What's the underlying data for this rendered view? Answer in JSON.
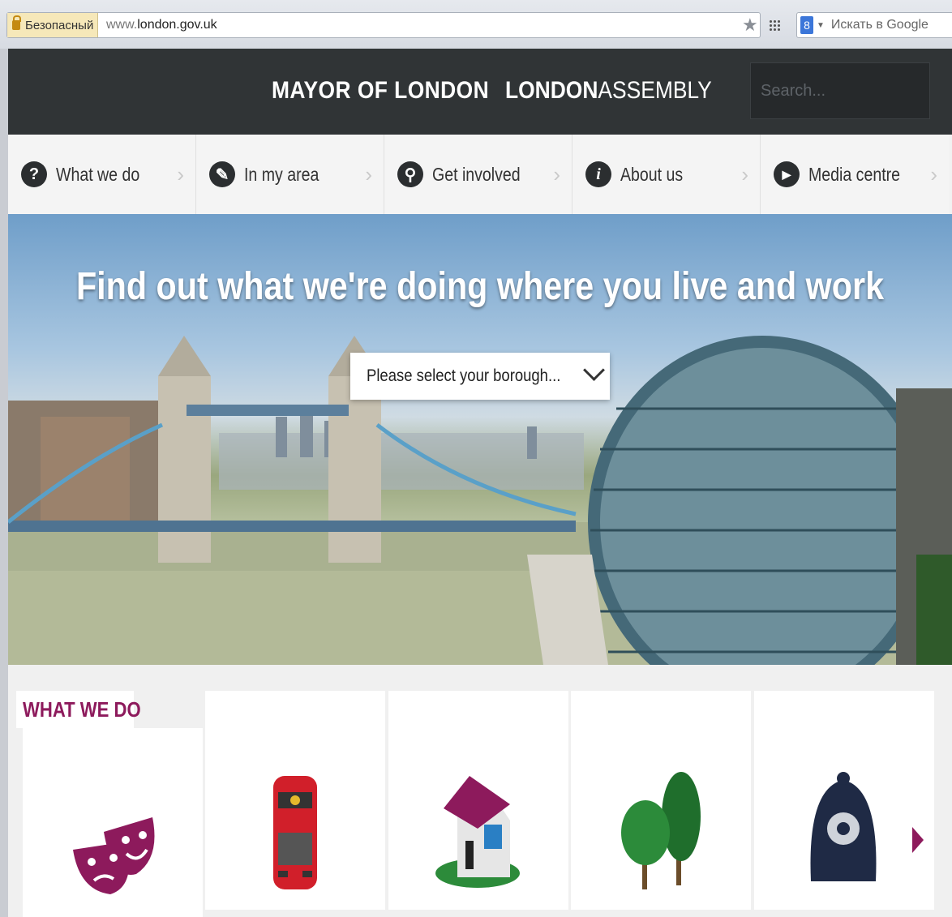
{
  "browser": {
    "security_label": "Безопасный",
    "url_prefix": "www.",
    "url_domain": "london.gov.uk",
    "search_placeholder": "Искать в Google",
    "search_engine_badge": "8"
  },
  "header": {
    "mayor_label": "MAYOR OF LONDON",
    "assembly_bold": "LONDON",
    "assembly_light": "ASSEMBLY",
    "search_placeholder": "Search..."
  },
  "nav": {
    "items": [
      {
        "label": "What we do",
        "icon": "question-icon",
        "glyph": "?"
      },
      {
        "label": "In my area",
        "icon": "pin-pen-icon",
        "glyph": "✎"
      },
      {
        "label": "Get involved",
        "icon": "location-pin-icon",
        "glyph": "⚲"
      },
      {
        "label": "About us",
        "icon": "info-icon",
        "glyph": "i"
      },
      {
        "label": "Media centre",
        "icon": "play-icon",
        "glyph": "▶"
      }
    ],
    "chevron": "›"
  },
  "hero": {
    "title": "Find out what we're doing where you live and work",
    "borough_select_label": "Please select your borough..."
  },
  "what_we_do": {
    "title": "WHAT WE DO",
    "cards": [
      {
        "icon": "theatre-masks-icon"
      },
      {
        "icon": "double-decker-bus-icon"
      },
      {
        "icon": "house-icon"
      },
      {
        "icon": "trees-icon"
      },
      {
        "icon": "police-helmet-icon"
      }
    ],
    "next_icon": "next-arrow-icon"
  },
  "colors": {
    "topbar": "#303436",
    "accent": "#8d1a5c",
    "nav_bg": "#f4f4f4"
  }
}
